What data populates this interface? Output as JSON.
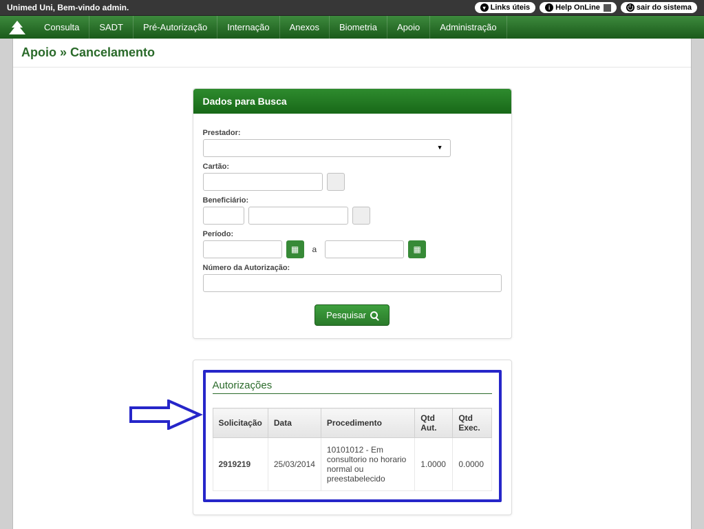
{
  "topbar": {
    "welcome": "Unimed Uni, Bem-vindo admin.",
    "links_uteis": "Links úteis",
    "help_online": "Help OnLine",
    "sair": "sair do sistema"
  },
  "nav": {
    "items": [
      "Consulta",
      "SADT",
      "Pré-Autorização",
      "Internação",
      "Anexos",
      "Biometria",
      "Apoio",
      "Administração"
    ]
  },
  "breadcrumb": "Apoio » Cancelamento",
  "search_card": {
    "title": "Dados para Busca",
    "labels": {
      "prestador": "Prestador:",
      "cartao": "Cartão:",
      "beneficiario": "Beneficiário:",
      "periodo": "Período:",
      "periodo_sep": "a",
      "num_autorizacao": "Número da Autorização:"
    },
    "values": {
      "prestador": "",
      "cartao": "",
      "beneficiario_code": "",
      "beneficiario_name": "",
      "periodo_ini": "",
      "periodo_fim": "",
      "num_autorizacao": ""
    },
    "button": "Pesquisar"
  },
  "results": {
    "title": "Autorizações",
    "columns": [
      "Solicitação",
      "Data",
      "Procedimento",
      "Qtd Aut.",
      "Qtd Exec."
    ],
    "rows": [
      {
        "solicitacao": "2919219",
        "data": "25/03/2014",
        "procedimento": "10101012 - Em consultorio no horario normal ou preestabelecido",
        "qtd_aut": "1.0000",
        "qtd_exec": "0.0000"
      }
    ]
  }
}
